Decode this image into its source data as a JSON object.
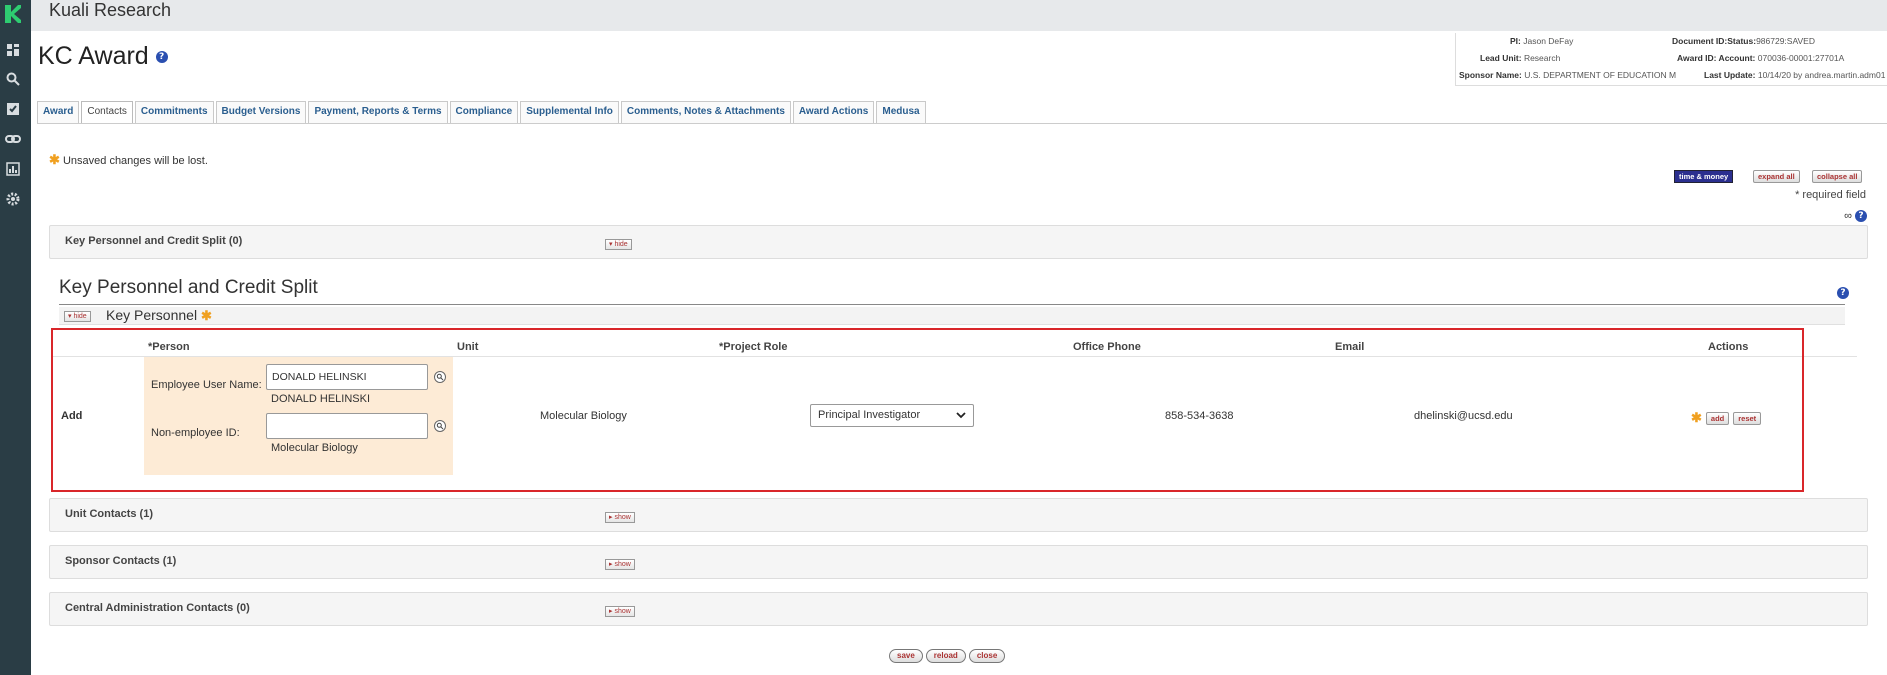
{
  "app": {
    "name": "Kuali Research"
  },
  "rail_icons": [
    "dashboard-icon",
    "search-icon",
    "checklist-icon",
    "link-icon",
    "report-icon",
    "gear-icon"
  ],
  "page": {
    "title": "KC Award"
  },
  "doc_info": {
    "pi_label": "PI:",
    "pi_value": "Jason DeFay",
    "docid_label": "Document ID:Status:",
    "docid_value": "986729:SAVED",
    "lead_label": "Lead Unit:",
    "lead_value": "Research",
    "award_label": "Award ID: Account:",
    "award_value": "070036-00001:27701A",
    "sponsor_label": "Sponsor Name:",
    "sponsor_value": "U.S. DEPARTMENT OF EDUCATION M",
    "update_label": "Last Update:",
    "update_value": "10/14/20 by andrea.martin.adm01"
  },
  "tabs": [
    {
      "label": "Award"
    },
    {
      "label": "Contacts"
    },
    {
      "label": "Commitments"
    },
    {
      "label": "Budget Versions"
    },
    {
      "label": "Payment, Reports & Terms"
    },
    {
      "label": "Compliance"
    },
    {
      "label": "Supplemental Info"
    },
    {
      "label": "Comments, Notes & Attachments"
    },
    {
      "label": "Award Actions"
    },
    {
      "label": "Medusa"
    }
  ],
  "notice": {
    "unsaved": "Unsaved changes will be lost."
  },
  "toolbar": {
    "time_money": "time & money",
    "expand_all": "expand all",
    "collapse_all": "collapse all",
    "required": "* required field",
    "link_symbol": "∞"
  },
  "sections": {
    "key_personnel_bar": "Key Personnel and Credit Split (0)",
    "hide": "hide",
    "show": "show",
    "unit_contacts": "Unit Contacts (1)",
    "sponsor_contacts": "Sponsor Contacts (1)",
    "central_admin": "Central Administration Contacts (0)"
  },
  "key_personnel": {
    "title": "Key Personnel and Credit Split",
    "sub_title": "Key Personnel",
    "columns": {
      "person": "*Person",
      "unit": "Unit",
      "project_role": "*Project Role",
      "office_phone": "Office Phone",
      "email": "Email",
      "actions": "Actions"
    },
    "row": {
      "add_label": "Add",
      "employee_label": "Employee User Name:",
      "employee_value": "DONALD HELINSKI",
      "employee_name": "DONALD HELINSKI",
      "nonemployee_label": "Non-employee ID:",
      "nonemployee_value": "",
      "person_unit": "Molecular Biology",
      "unit": "Molecular Biology",
      "project_role": "Principal Investigator",
      "office_phone": "858-534-3638",
      "email": "dhelinski@ucsd.edu",
      "add_btn": "add",
      "reset_btn": "reset"
    }
  },
  "bottom": {
    "save": "save",
    "reload": "reload",
    "close": "close"
  }
}
